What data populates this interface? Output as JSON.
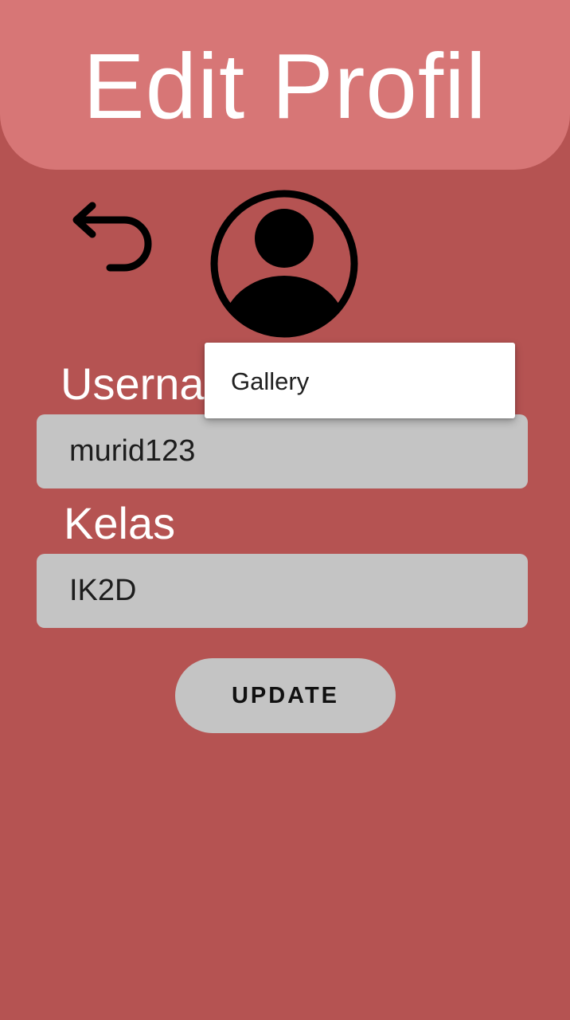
{
  "header": {
    "title": "Edit Profil"
  },
  "icons": {
    "back": "undo-arrow-icon",
    "avatar": "account-circle-icon"
  },
  "form": {
    "username": {
      "label": "Username",
      "value": "murid123"
    },
    "kelas": {
      "label": "Kelas",
      "value": "IK2D"
    }
  },
  "actions": {
    "update_label": "UPDATE"
  },
  "popup_menu": {
    "items": [
      "Gallery"
    ]
  },
  "colors": {
    "background": "#b55352",
    "header": "#d77676",
    "field": "#c4c4c4",
    "menu": "#ffffff"
  }
}
